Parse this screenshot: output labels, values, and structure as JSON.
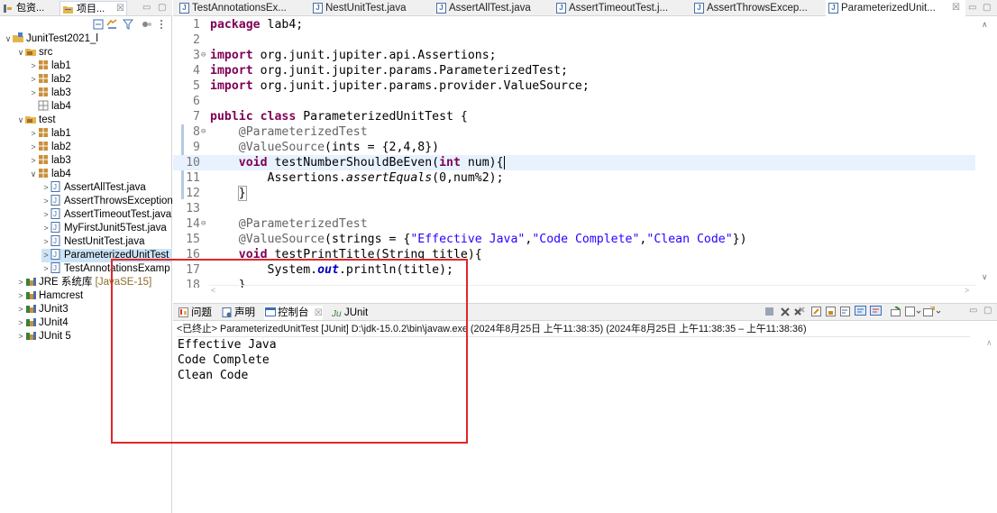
{
  "left_panel": {
    "tabs": [
      {
        "label": "包资...",
        "icon": "package-explorer-icon"
      },
      {
        "label": "项目...",
        "icon": "project-explorer-icon"
      }
    ],
    "close_glyph": "☒",
    "tree": [
      {
        "label": "JunitTest2021_l",
        "icon": "project-icon",
        "arrow": "∨"
      },
      {
        "label": "src",
        "icon": "source-folder-icon",
        "arrow": "∨"
      },
      {
        "label": "lab1",
        "icon": "package-icon",
        "arrow": ">"
      },
      {
        "label": "lab2",
        "icon": "package-icon",
        "arrow": ">"
      },
      {
        "label": "lab3",
        "icon": "package-icon",
        "arrow": ">"
      },
      {
        "label": "lab4",
        "icon": "package-icon",
        "arrow": ""
      },
      {
        "label": "test",
        "icon": "source-folder-icon",
        "arrow": "∨"
      },
      {
        "label": "lab1",
        "icon": "package-icon",
        "arrow": ">"
      },
      {
        "label": "lab2",
        "icon": "package-icon",
        "arrow": ">"
      },
      {
        "label": "lab3",
        "icon": "package-icon",
        "arrow": ">"
      },
      {
        "label": "lab4",
        "icon": "package-icon",
        "arrow": "∨"
      },
      {
        "label": "AssertAllTest.java",
        "icon": "java-file-icon",
        "arrow": ">"
      },
      {
        "label": "AssertThrowsException",
        "icon": "java-file-icon",
        "arrow": ">"
      },
      {
        "label": "AssertTimeoutTest.java",
        "icon": "java-file-icon",
        "arrow": ">"
      },
      {
        "label": "MyFirstJunit5Test.java",
        "icon": "java-file-icon",
        "arrow": ">"
      },
      {
        "label": "NestUnitTest.java",
        "icon": "java-file-icon",
        "arrow": ">"
      },
      {
        "label": "ParameterizedUnitTest",
        "icon": "java-file-icon",
        "arrow": ">"
      },
      {
        "label": "TestAnnotationsExamp",
        "icon": "java-file-icon",
        "arrow": ">"
      },
      {
        "label": "JRE 系统库",
        "decoration": "[JavaSE-15]",
        "icon": "library-icon",
        "arrow": ">"
      },
      {
        "label": "Hamcrest",
        "icon": "library-icon",
        "arrow": ">"
      },
      {
        "label": "JUnit3",
        "icon": "library-icon",
        "arrow": ">"
      },
      {
        "label": "JUnit4",
        "icon": "library-icon",
        "arrow": ">"
      },
      {
        "label": "JUnit 5",
        "icon": "library-icon",
        "arrow": ">"
      }
    ]
  },
  "editor": {
    "tabs": [
      {
        "label": "TestAnnotationsEx..."
      },
      {
        "label": "NestUnitTest.java"
      },
      {
        "label": "AssertAllTest.java"
      },
      {
        "label": "AssertTimeoutTest.j..."
      },
      {
        "label": "AssertThrowsExcep..."
      },
      {
        "label": "ParameterizedUnit..."
      }
    ],
    "active_tab_close": "☒",
    "lines": [
      {
        "n": "1"
      },
      {
        "n": "2"
      },
      {
        "n": "3"
      },
      {
        "n": "4"
      },
      {
        "n": "5"
      },
      {
        "n": "6"
      },
      {
        "n": "7"
      },
      {
        "n": "8"
      },
      {
        "n": "9"
      },
      {
        "n": "10"
      },
      {
        "n": "11"
      },
      {
        "n": "12"
      },
      {
        "n": "13"
      },
      {
        "n": "14"
      },
      {
        "n": "15"
      },
      {
        "n": "16"
      },
      {
        "n": "17"
      },
      {
        "n": "18"
      }
    ],
    "tokens": {
      "l1_kw": "package",
      "l1_rest": " lab4;",
      "import": "import",
      "l3": " org.junit.jupiter.api.Assertions;",
      "l4": " org.junit.jupiter.params.ParameterizedTest;",
      "l5": " org.junit.jupiter.params.provider.ValueSource;",
      "l7_kw1": "public",
      "l7_kw2": "class",
      "l7_rest": " ParameterizedUnitTest {",
      "l8_ann": "@ParameterizedTest",
      "l9_ann": "@ValueSource",
      "l9_rest": "(ints = {2,4,8})",
      "l10_kw": "void",
      "l10_a": " testNumberShouldBeEven(",
      "l10_kw2": "int",
      "l10_b": " num){",
      "l11_a": "Assertions.",
      "l11_it": "assertEquals",
      "l11_b": "(0,num%2);",
      "l12": "}",
      "l14_ann": "@ParameterizedTest",
      "l15_ann": "@ValueSource",
      "l15_a": "(strings = {",
      "l15_s1": "\"Effective Java\"",
      "l15_c1": ",",
      "l15_s2": "\"Code Complete\"",
      "l15_c2": ",",
      "l15_s3": "\"Clean Code\"",
      "l15_b": "})",
      "l16_kw": "void",
      "l16_a": " testPrintTitle(String title){",
      "l17_a": "System.",
      "l17_f": "out",
      "l17_b": ".println(title);",
      "l18": "}"
    }
  },
  "console": {
    "tabs": [
      {
        "label": "问题",
        "icon": "problems-icon"
      },
      {
        "label": "声明",
        "icon": "declaration-icon"
      },
      {
        "label": "控制台",
        "icon": "console-icon"
      },
      {
        "label": "JUnit",
        "icon": "junit-icon"
      }
    ],
    "status": "<已终止> ParameterizedUnitTest [JUnit] D:\\jdk-15.0.2\\bin\\javaw.exe  (2024年8月25日 上午11:38:35)  (2024年8月25日 上午11:38:35 – 上午11:38:36)",
    "output": [
      "Effective Java",
      "Code Complete",
      "Clean Code"
    ]
  },
  "colors": {
    "keyword": "#7f0055",
    "annotation": "#646464",
    "string": "#2a00ff",
    "field": "#0000c0",
    "highlight_box": "#e0262b",
    "current_line": "#e8f2fe"
  }
}
